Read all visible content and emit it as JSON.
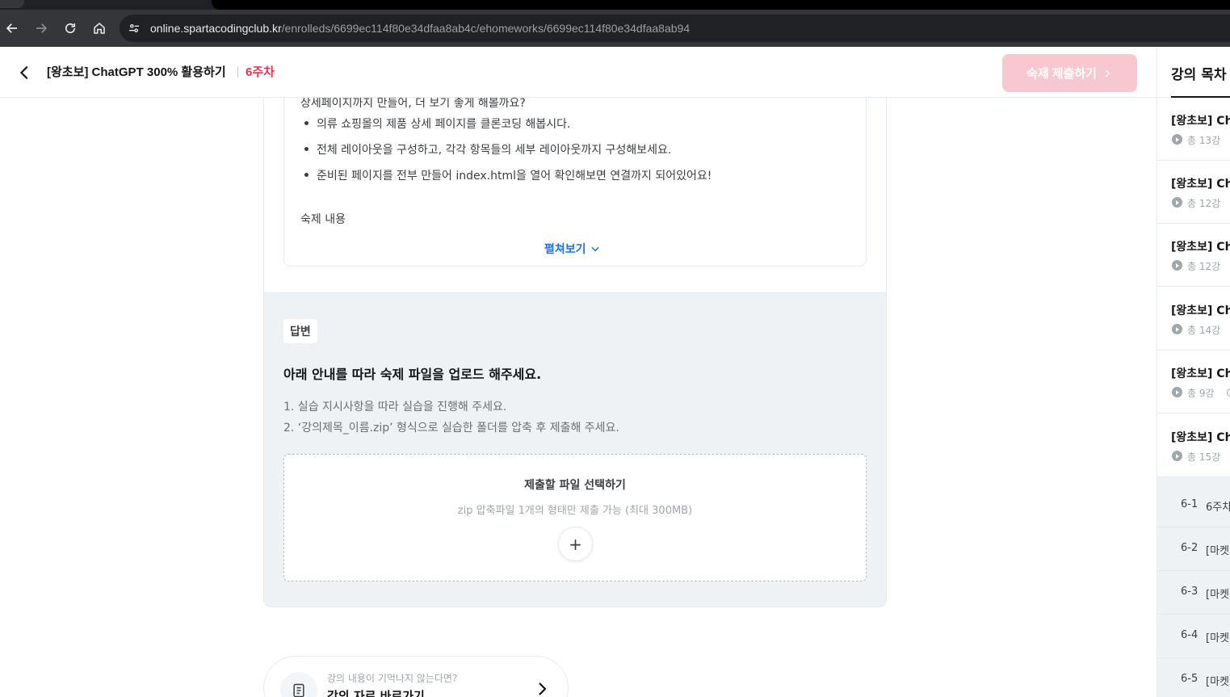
{
  "browser": {
    "url_host": "online.spartacodingclub.kr",
    "url_path": "/enrolleds/6699ec114f80e34dfaa8ab4c/ehomeworks/6699ec114f80e34dfaa8ab94"
  },
  "header": {
    "course_title": "[왕초보] ChatGPT 300% 활용하기",
    "week": "6주차",
    "submit_label": "숙제 제출하기",
    "submit_color": "#f7c8cf",
    "week_color": "#e8344e"
  },
  "question": {
    "cut_line": "상세페이지까지 만들어, 더 보기 좋게 해볼까요?",
    "bullets": [
      "의류 쇼핑몰의 제품 상세 페이지를 클론코딩 해봅시다.",
      "전체 레이아웃을 구성하고, 각각 항목들의 세부 레이아웃까지 구성해보세요.",
      "준비된 페이지를 전부 만들어 index.html을 열어 확인해보면 연결까지 되어있어요!"
    ],
    "homework_title": "숙제 내용",
    "expand_label": "펼쳐보기"
  },
  "answer": {
    "badge": "답변",
    "heading": "아래 안내를 따라 숙제 파일을 업로드 해주세요.",
    "instructions": [
      "1. 실습 지시사항을 따라 실습을 진행해 주세요.",
      "2. ‘강의제목_이름.zip’ 형식으로 실습한 폴더를 압축 후 제출해 주세요."
    ],
    "dropzone_title": "제출할 파일 선택하기",
    "dropzone_sub": "zip 압축파일 1개의 형태만 제출 가능 (최대 300MB)",
    "add_symbol": "+"
  },
  "lecture_link": {
    "sub": "강의 내용이 기억나지 않는다면?",
    "main": "강의 자료 바로가기"
  },
  "sidebar": {
    "title": "강의 목차",
    "weeks": [
      {
        "name": "[왕초보] Ch",
        "count": "총 13강"
      },
      {
        "name": "[왕초보] Ch",
        "count": "총 12강"
      },
      {
        "name": "[왕초보] Ch",
        "count": "총 12강"
      },
      {
        "name": "[왕초보] Ch",
        "count": "총 14강"
      },
      {
        "name": "[왕초보] Ch",
        "count": "총 9강"
      },
      {
        "name": "[왕초보] Ch",
        "count": "총 15강"
      }
    ],
    "sub_items": [
      {
        "num": "6-1",
        "text": "6주차"
      },
      {
        "num": "6-2",
        "text": "[마켓"
      },
      {
        "num": "6-3",
        "text": "[마켓"
      },
      {
        "num": "6-4",
        "text": "[마켓"
      },
      {
        "num": "6-5",
        "text": "[마켓"
      }
    ]
  }
}
